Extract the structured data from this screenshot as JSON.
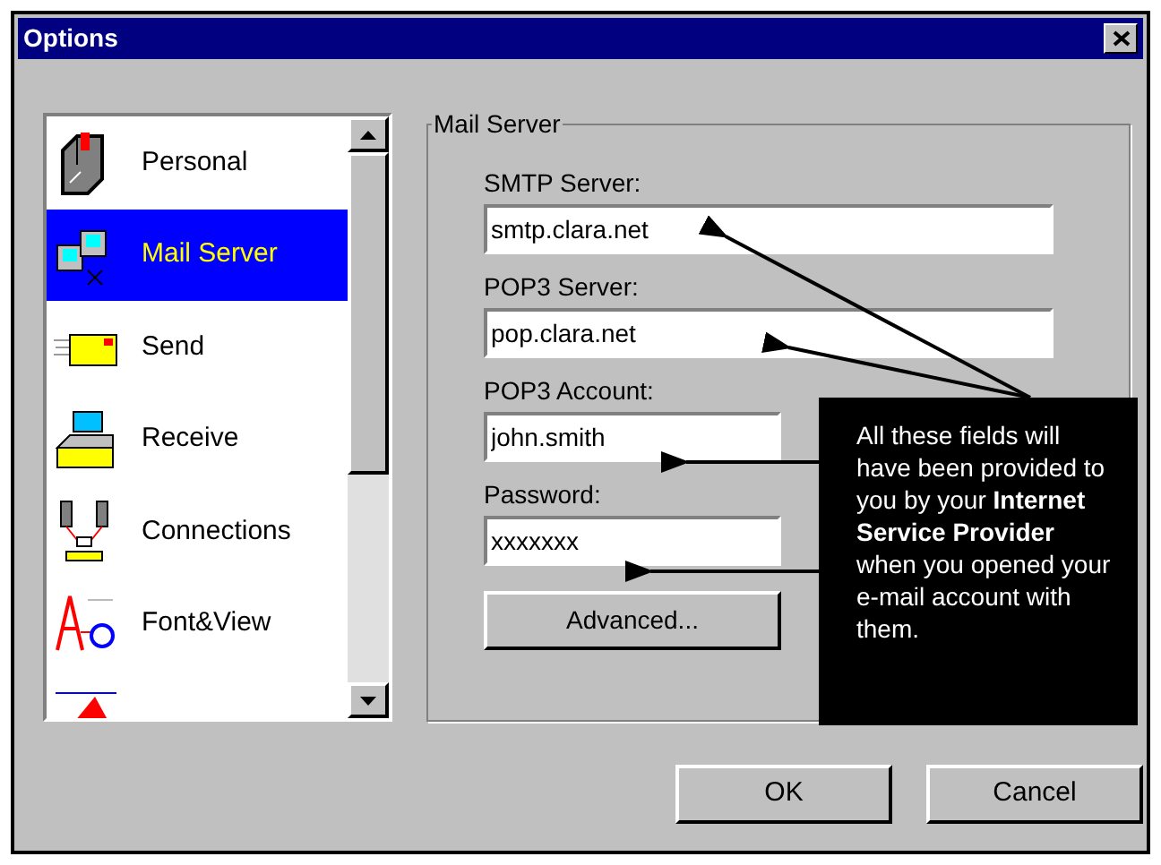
{
  "window": {
    "title": "Options"
  },
  "categories": [
    {
      "label": "Personal",
      "kind": "mailbox",
      "selected": false
    },
    {
      "label": "Mail Server",
      "kind": "servers",
      "selected": true
    },
    {
      "label": "Send",
      "kind": "envelope",
      "selected": false
    },
    {
      "label": "Receive",
      "kind": "tray",
      "selected": false
    },
    {
      "label": "Connections",
      "kind": "network",
      "selected": false
    },
    {
      "label": "Font&View",
      "kind": "font",
      "selected": false
    },
    {
      "kind": "label",
      "selected": false
    }
  ],
  "group": {
    "title": "Mail Server",
    "fields": [
      {
        "label": "SMTP Server:",
        "value": "smtp.clara.net",
        "kind": "wide"
      },
      {
        "label": "POP3 Server:",
        "value": "pop.clara.net",
        "kind": "wide"
      },
      {
        "label": "POP3 Account:",
        "value": "john.smith",
        "kind": "narrow"
      },
      {
        "label": "Password:",
        "value": "xxxxxxx",
        "kind": "narrow"
      }
    ],
    "advanced_button": "Advanced..."
  },
  "callout": "All these fields will have been provided to you by your  **Internet Service Provider** when you opened your e-mail account with them.",
  "buttons": [
    "OK",
    "Cancel"
  ]
}
